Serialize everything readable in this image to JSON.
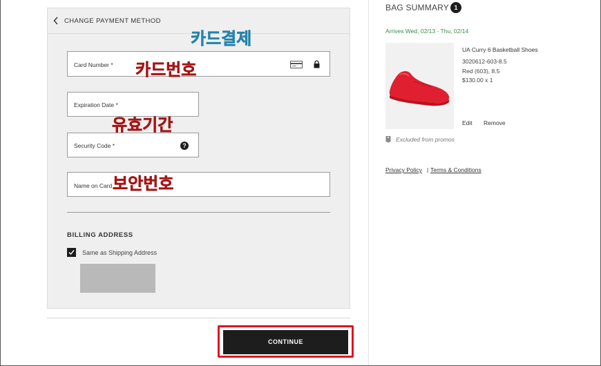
{
  "payment": {
    "header": "CHANGE PAYMENT METHOD",
    "card_number_label": "Card Number *",
    "expiration_label": "Expiration Date *",
    "security_label": "Security Code *",
    "name_label": "Name on Card",
    "help_glyph": "?",
    "billing_title": "BILLING ADDRESS",
    "same_as_shipping": "Same as Shipping Address",
    "continue_label": "CONTINUE"
  },
  "annotations": {
    "card_payment": "카드결제",
    "card_number": "카드번호",
    "expiry": "유효기간",
    "security": "보안번호",
    "teal_color": "#2f97c4",
    "red_color": "#c11a1a"
  },
  "bag": {
    "title": "BAG SUMMARY",
    "count": "1",
    "arrives": "Arrives Wed, 02/13 - Thu, 02/14",
    "items": [
      {
        "name": "UA Curry 6 Basketball Shoes",
        "sku": "3020612-603-8.5",
        "variant": "Red (603), 8.5",
        "price_qty": "$130.00 x 1",
        "edit_label": "Edit",
        "remove_label": "Remove"
      }
    ],
    "promo_note": "Excluded from promos"
  },
  "footer": {
    "privacy": "Privacy Policy",
    "separator": "|",
    "terms": "Terms & Conditions"
  },
  "colors": {
    "accent": "#1d1d1d",
    "highlight_outline": "#e0141e",
    "arrives_green": "#3a8a4a",
    "shoe_red": "#e02030"
  }
}
